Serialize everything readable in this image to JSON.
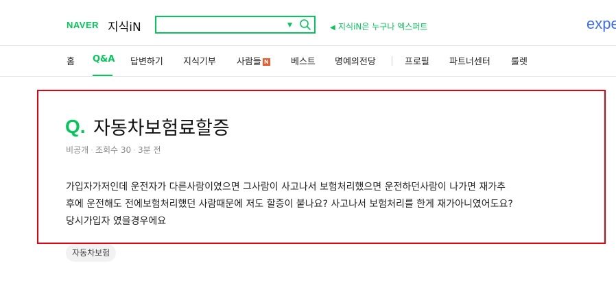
{
  "header": {
    "naver_logo": "NAVER",
    "service_name": "지식iN",
    "search": {
      "value": "",
      "placeholder": ""
    },
    "notice": "지식iN은 누구나 엑스퍼트",
    "expert_logo": "expe"
  },
  "nav": {
    "items": [
      "홈",
      "Q&A",
      "답변하기",
      "지식기부",
      "사람들",
      "베스트",
      "명예의전당",
      "프로필",
      "파트너센터",
      "룰렛"
    ],
    "active": "Q&A",
    "new_badge": "N"
  },
  "question": {
    "mark": "Q.",
    "title": "자동차보험료할증",
    "author": "비공개",
    "views": "조회수 30",
    "time": "3분 전",
    "body_lines": [
      "가입자가저인데 운전자가 다른사람이였으면 그사람이 사고나서 보험처리했으면 운전하던사람이 나가면 재가추",
      "후에 운전해도 전에보험처리했던 사람때문에 저도 할증이 붙나요? 사고나서 보험처리를 한게 재가아니였어도요?",
      "당시가입자 였을경우에요"
    ],
    "tag": "자동차보험"
  },
  "colors": {
    "brand": "#03c75a",
    "highlight_box": "#e4000f",
    "expert": "#3c6cf0",
    "badge": "#f0592a"
  }
}
